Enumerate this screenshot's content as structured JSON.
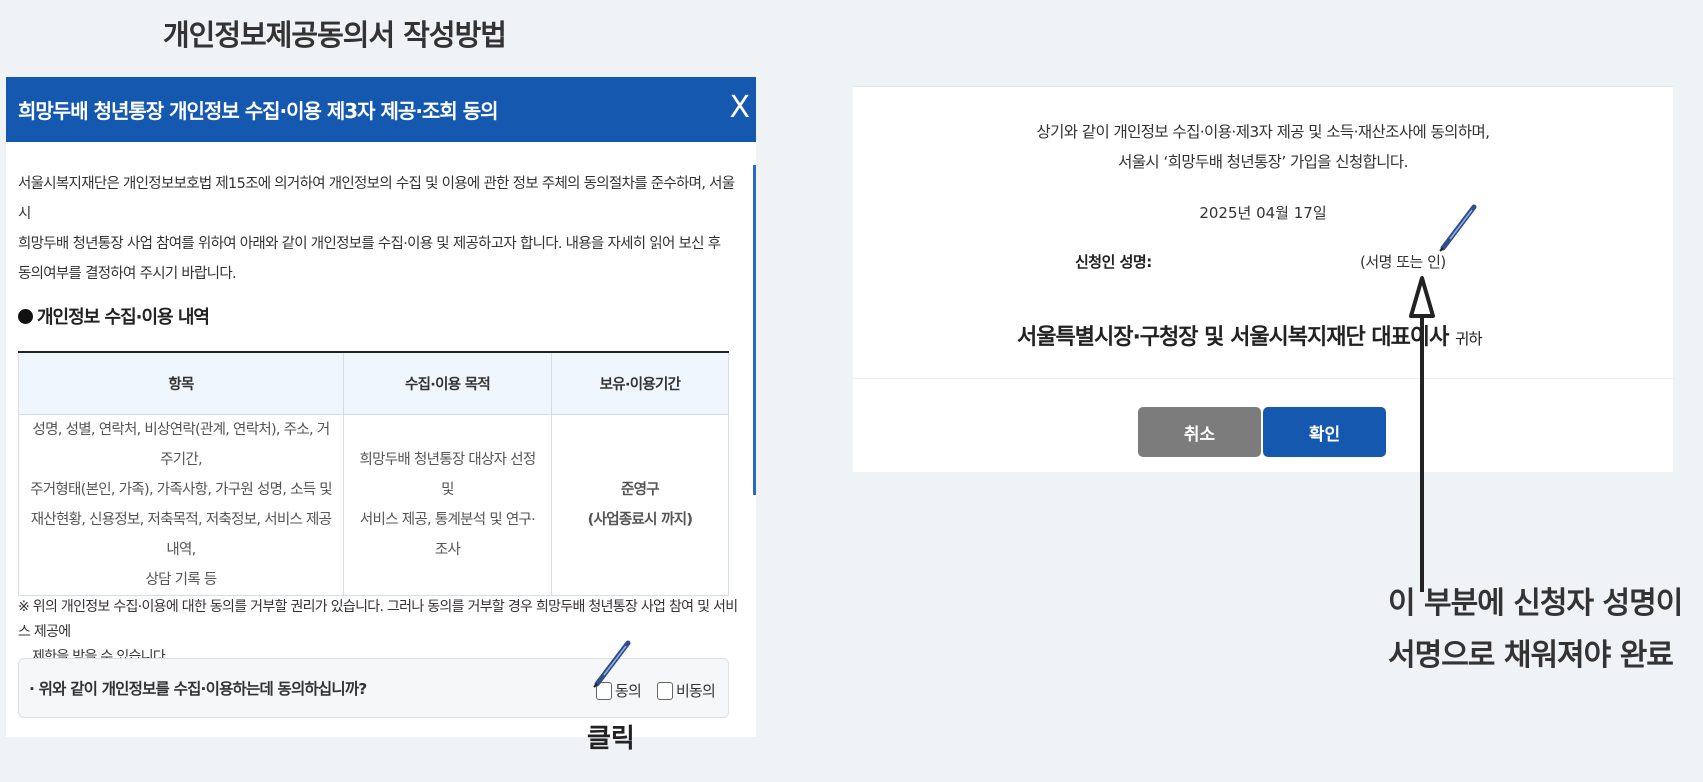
{
  "page_title": "개인정보제공동의서 작성방법",
  "dialog": {
    "title": "희망두배 청년통장 개인정보 수집·이용 제3자 제공·조회 동의",
    "close_label": "X",
    "intro_lines": [
      "서울시복지재단은 개인정보보호법 제15조에 의거하여 개인정보의 수집 및 이용에 관한 정보 주체의 동의절차를 준수하며, 서울시",
      "희망두배 청년통장 사업 참여를 위하여 아래와 같이 개인정보를 수집·이용 및 제공하고자 합니다. 내용을 자세히 읽어 보신 후",
      "동의여부를 결정하여 주시기 바랍니다."
    ],
    "section_title": "개인정보 수집·이용 내역",
    "table": {
      "headers": [
        "항목",
        "수집·이용 목적",
        "보유·이용기간"
      ],
      "items_lines": [
        "성명, 성별, 연락처, 비상연락(관계, 연락처), 주소, 거주기간,",
        "주거형태(본인, 가족), 가족사항, 가구원 성명, 소득 및",
        "재산현황, 신용정보, 저축목적, 저축정보, 서비스 제공 내역,",
        "상담 기록 등"
      ],
      "purpose_lines": [
        "희망두배 청년통장 대상자 선정 및",
        "서비스 제공, 통계분석 및 연구·조사"
      ],
      "period_lines": [
        "준영구",
        "(사업종료시 까지)"
      ]
    },
    "notice_lines": [
      "※ 위의 개인정보 수집·이용에 대한 동의를 거부할 권리가 있습니다. 그러나 동의를 거부할 경우 희망두배 청년통장 사업 참여 및 서비스 제공에",
      "제한을 받을 수 있습니다."
    ],
    "consent_question": "· 위와 같이 개인정보를 수집·이용하는데 동의하십니까?",
    "agree_label": "동의",
    "disagree_label": "비동의"
  },
  "click_label": "클릭",
  "right_panel": {
    "statement_lines": [
      "상기와 같이 개인정보 수집·이용·제3자 제공 및 소득·재산조사에 동의하며,",
      "서울시 ‘희망두배 청년통장’ 가입을 신청합니다."
    ],
    "date": "2025년 04월 17일",
    "applicant_label": "신청인 성명:",
    "signature_placeholder": "(서명 또는 인)",
    "addressee": "서울특별시장·구청장 및 서울시복지재단 대표이사",
    "addressee_suffix": "귀하",
    "cancel_label": "취소",
    "confirm_label": "확인"
  },
  "callout_lines": [
    "이 부분에 신청자 성명이",
    "서명으로 채워져야 완료"
  ],
  "colors": {
    "primary": "#1458b0",
    "cancel": "#7c7c7c",
    "header_bg": "#f0f6fd"
  },
  "icons": [
    "close-icon",
    "pen-icon",
    "arrow-up-icon",
    "bullet-dot-icon"
  ]
}
